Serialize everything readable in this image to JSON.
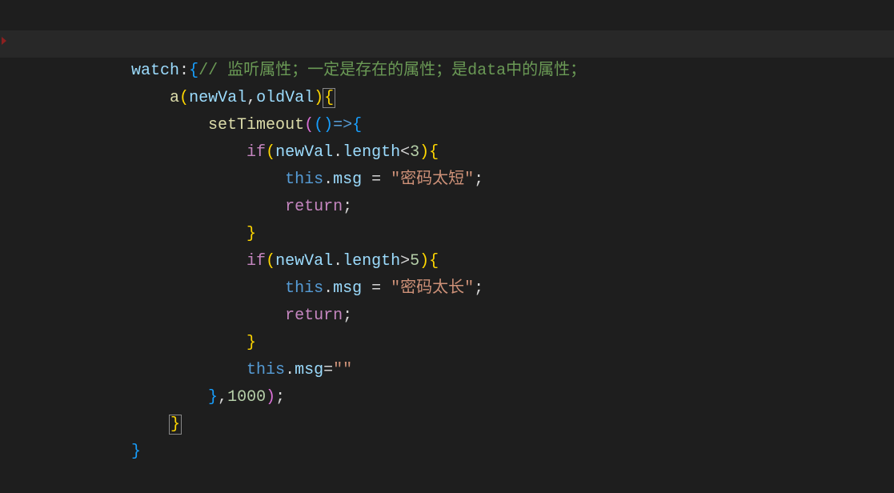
{
  "code": {
    "lines": [
      {
        "indent": 3,
        "tokens": [
          {
            "t": "watch",
            "c": "kw-prop"
          },
          {
            "t": ":",
            "c": "punct"
          },
          {
            "t": "{",
            "c": "bracket3"
          },
          {
            "t": "// 监听属性；一定是存在的属性；是data中的属性；",
            "c": "comment"
          }
        ]
      },
      {
        "indent": 4,
        "highlight": true,
        "tokens": [
          {
            "t": "a",
            "c": "func"
          },
          {
            "t": "(",
            "c": "bracket1"
          },
          {
            "t": "newVal",
            "c": "var"
          },
          {
            "t": ",",
            "c": "punct"
          },
          {
            "t": "oldVal",
            "c": "var"
          },
          {
            "t": ")",
            "c": "bracket1"
          },
          {
            "t": "{",
            "c": "bracket1",
            "boxed": true
          }
        ]
      },
      {
        "indent": 5,
        "tokens": [
          {
            "t": "setTimeout",
            "c": "func"
          },
          {
            "t": "(",
            "c": "bracket2"
          },
          {
            "t": "(",
            "c": "bracket3"
          },
          {
            "t": ")",
            "c": "bracket3"
          },
          {
            "t": "=>",
            "c": "this"
          },
          {
            "t": "{",
            "c": "bracket3"
          }
        ]
      },
      {
        "indent": 6,
        "tokens": [
          {
            "t": "if",
            "c": "kw-ctrl"
          },
          {
            "t": "(",
            "c": "bracket1"
          },
          {
            "t": "newVal",
            "c": "var"
          },
          {
            "t": ".",
            "c": "punct"
          },
          {
            "t": "length",
            "c": "var"
          },
          {
            "t": "<",
            "c": "punct"
          },
          {
            "t": "3",
            "c": "num"
          },
          {
            "t": ")",
            "c": "bracket1"
          },
          {
            "t": "{",
            "c": "bracket1"
          }
        ]
      },
      {
        "indent": 7,
        "tokens": [
          {
            "t": "this",
            "c": "this"
          },
          {
            "t": ".",
            "c": "punct"
          },
          {
            "t": "msg",
            "c": "var"
          },
          {
            "t": " ",
            "c": "punct"
          },
          {
            "t": "=",
            "c": "punct"
          },
          {
            "t": " ",
            "c": "punct"
          },
          {
            "t": "\"密码太短\"",
            "c": "str"
          },
          {
            "t": ";",
            "c": "punct"
          }
        ]
      },
      {
        "indent": 7,
        "tokens": [
          {
            "t": "return",
            "c": "kw-ctrl"
          },
          {
            "t": ";",
            "c": "punct"
          }
        ]
      },
      {
        "indent": 6,
        "tokens": [
          {
            "t": "}",
            "c": "bracket1"
          }
        ]
      },
      {
        "indent": 6,
        "tokens": [
          {
            "t": "if",
            "c": "kw-ctrl"
          },
          {
            "t": "(",
            "c": "bracket1"
          },
          {
            "t": "newVal",
            "c": "var"
          },
          {
            "t": ".",
            "c": "punct"
          },
          {
            "t": "length",
            "c": "var"
          },
          {
            "t": ">",
            "c": "punct"
          },
          {
            "t": "5",
            "c": "num"
          },
          {
            "t": ")",
            "c": "bracket1"
          },
          {
            "t": "{",
            "c": "bracket1"
          }
        ]
      },
      {
        "indent": 7,
        "tokens": [
          {
            "t": "this",
            "c": "this"
          },
          {
            "t": ".",
            "c": "punct"
          },
          {
            "t": "msg",
            "c": "var"
          },
          {
            "t": " ",
            "c": "punct"
          },
          {
            "t": "=",
            "c": "punct"
          },
          {
            "t": " ",
            "c": "punct"
          },
          {
            "t": "\"密码太长\"",
            "c": "str"
          },
          {
            "t": ";",
            "c": "punct"
          }
        ]
      },
      {
        "indent": 7,
        "tokens": [
          {
            "t": "return",
            "c": "kw-ctrl"
          },
          {
            "t": ";",
            "c": "punct"
          }
        ]
      },
      {
        "indent": 6,
        "tokens": [
          {
            "t": "}",
            "c": "bracket1"
          }
        ]
      },
      {
        "indent": 6,
        "tokens": [
          {
            "t": "this",
            "c": "this"
          },
          {
            "t": ".",
            "c": "punct"
          },
          {
            "t": "msg",
            "c": "var"
          },
          {
            "t": "=",
            "c": "punct"
          },
          {
            "t": "\"\"",
            "c": "str"
          }
        ]
      },
      {
        "indent": 5,
        "tokens": [
          {
            "t": "}",
            "c": "bracket3"
          },
          {
            "t": ",",
            "c": "punct"
          },
          {
            "t": "1000",
            "c": "num"
          },
          {
            "t": ")",
            "c": "bracket2"
          },
          {
            "t": ";",
            "c": "punct"
          }
        ]
      },
      {
        "indent": 4,
        "tokens": [
          {
            "t": "}",
            "c": "bracket1",
            "boxed": true
          }
        ]
      },
      {
        "indent": 3,
        "tokens": [
          {
            "t": "}",
            "c": "bracket3"
          }
        ]
      }
    ],
    "indentSize": "    "
  }
}
